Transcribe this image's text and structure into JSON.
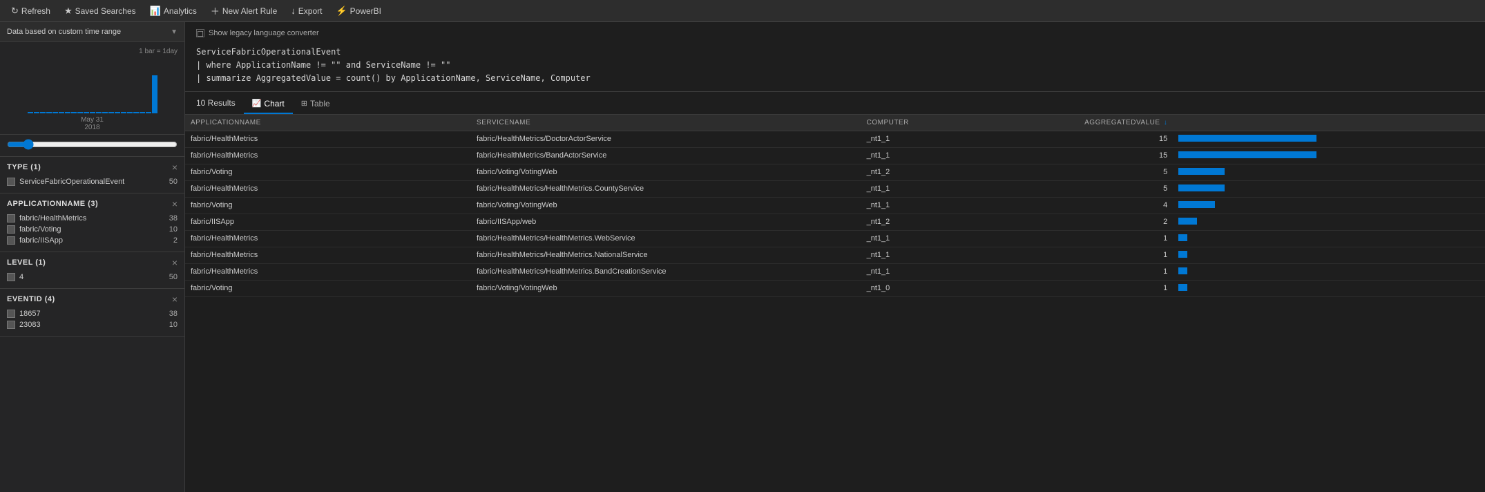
{
  "topNav": {
    "refresh": "Refresh",
    "savedSearches": "Saved Searches",
    "analytics": "Analytics",
    "newAlertRule": "New Alert Rule",
    "export": "Export",
    "powerBI": "PowerBI"
  },
  "sidebar": {
    "timeRange": "Data based on custom time range",
    "histogramLabel": "1 bar = 1day",
    "histogramDate": "May 31\n2018",
    "filters": [
      {
        "id": "type",
        "title": "TYPE (1)",
        "items": [
          {
            "label": "ServiceFabricOperationalEvent",
            "count": 50
          }
        ]
      },
      {
        "id": "applicationName",
        "title": "APPLICATIONNAME (3)",
        "items": [
          {
            "label": "fabric/HealthMetrics",
            "count": 38
          },
          {
            "label": "fabric/Voting",
            "count": 10
          },
          {
            "label": "fabric/IISApp",
            "count": 2
          }
        ]
      },
      {
        "id": "level",
        "title": "LEVEL (1)",
        "items": [
          {
            "label": "4",
            "count": 50
          }
        ]
      },
      {
        "id": "eventid",
        "title": "EVENTID (4)",
        "items": [
          {
            "label": "18657",
            "count": 38
          },
          {
            "label": "23083",
            "count": 10
          }
        ]
      }
    ]
  },
  "query": {
    "showLegacy": "Show legacy language converter",
    "lines": [
      "ServiceFabricOperationalEvent",
      "| where ApplicationName != \"\" and ServiceName != \"\"",
      "| summarize AggregatedValue = count() by ApplicationName, ServiceName, Computer"
    ]
  },
  "results": {
    "count": "10",
    "label": "Results",
    "tabs": [
      {
        "id": "chart",
        "label": "Chart",
        "icon": "📈"
      },
      {
        "id": "table",
        "label": "Table",
        "icon": "⊞"
      }
    ],
    "activeTab": "chart",
    "columns": [
      {
        "id": "applicationname",
        "label": "APPLICATIONNAME"
      },
      {
        "id": "servicename",
        "label": "SERVICENAME"
      },
      {
        "id": "computer",
        "label": "COMPUTER"
      },
      {
        "id": "aggregatedvalue",
        "label": "AGGREGATEDVALUE ↓"
      }
    ],
    "rows": [
      {
        "applicationname": "fabric/HealthMetrics",
        "servicename": "fabric/HealthMetrics/DoctorActorService",
        "computer": "_nt1_1",
        "aggregatedvalue": 15
      },
      {
        "applicationname": "fabric/HealthMetrics",
        "servicename": "fabric/HealthMetrics/BandActorService",
        "computer": "_nt1_1",
        "aggregatedvalue": 15
      },
      {
        "applicationname": "fabric/Voting",
        "servicename": "fabric/Voting/VotingWeb",
        "computer": "_nt1_2",
        "aggregatedvalue": 5
      },
      {
        "applicationname": "fabric/HealthMetrics",
        "servicename": "fabric/HealthMetrics/HealthMetrics.CountyService",
        "computer": "_nt1_1",
        "aggregatedvalue": 5
      },
      {
        "applicationname": "fabric/Voting",
        "servicename": "fabric/Voting/VotingWeb",
        "computer": "_nt1_1",
        "aggregatedvalue": 4
      },
      {
        "applicationname": "fabric/IISApp",
        "servicename": "fabric/IISApp/web",
        "computer": "_nt1_2",
        "aggregatedvalue": 2
      },
      {
        "applicationname": "fabric/HealthMetrics",
        "servicename": "fabric/HealthMetrics/HealthMetrics.WebService",
        "computer": "_nt1_1",
        "aggregatedvalue": 1
      },
      {
        "applicationname": "fabric/HealthMetrics",
        "servicename": "fabric/HealthMetrics/HealthMetrics.NationalService",
        "computer": "_nt1_1",
        "aggregatedvalue": 1
      },
      {
        "applicationname": "fabric/HealthMetrics",
        "servicename": "fabric/HealthMetrics/HealthMetrics.BandCreationService",
        "computer": "_nt1_1",
        "aggregatedvalue": 1
      },
      {
        "applicationname": "fabric/Voting",
        "servicename": "fabric/Voting/VotingWeb",
        "computer": "_nt1_0",
        "aggregatedvalue": 1
      }
    ],
    "maxValue": 15
  }
}
